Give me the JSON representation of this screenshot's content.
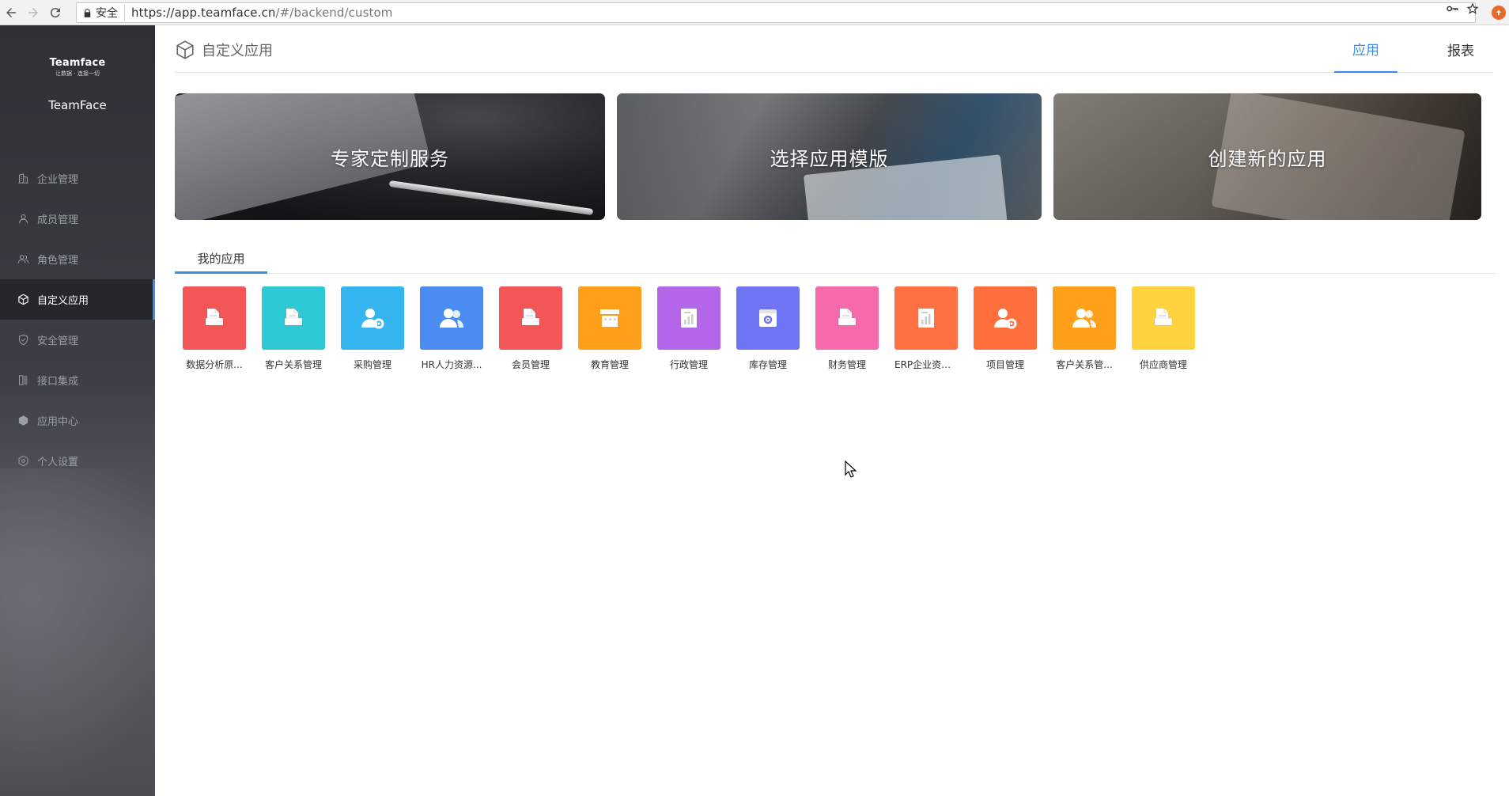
{
  "browser": {
    "security_label": "安全",
    "url_host": "https://app.teamface.cn",
    "url_path": "/#/backend/custom"
  },
  "sidebar": {
    "logo_text": "Teamface",
    "logo_sub": "让数据 · 连接一切",
    "org_name": "TeamFace",
    "items": [
      {
        "label": "企业管理",
        "icon": "building-icon"
      },
      {
        "label": "成员管理",
        "icon": "user-icon"
      },
      {
        "label": "角色管理",
        "icon": "users-icon"
      },
      {
        "label": "自定义应用",
        "icon": "cube-icon",
        "active": true
      },
      {
        "label": "安全管理",
        "icon": "shield-icon"
      },
      {
        "label": "接口集成",
        "icon": "plug-icon"
      },
      {
        "label": "应用中心",
        "icon": "box-icon"
      },
      {
        "label": "个人设置",
        "icon": "gear-icon"
      }
    ]
  },
  "header": {
    "title": "自定义应用",
    "tabs": [
      {
        "label": "应用",
        "active": true
      },
      {
        "label": "报表",
        "active": false
      }
    ]
  },
  "banners": [
    {
      "label": "专家定制服务"
    },
    {
      "label": "选择应用模版"
    },
    {
      "label": "创建新的应用"
    }
  ],
  "sub_tabs": [
    {
      "label": "我的应用",
      "active": true
    }
  ],
  "apps": [
    {
      "name": "数据分析原...",
      "color": "#f25656",
      "icon": "doc-icon"
    },
    {
      "name": "客户关系管理",
      "color": "#2ec9d4",
      "icon": "doc-icon"
    },
    {
      "name": "采购管理",
      "color": "#35b5f0",
      "icon": "user-gear-icon"
    },
    {
      "name": "HR人力资源...",
      "color": "#4a8cf2",
      "icon": "users-icon"
    },
    {
      "name": "会员管理",
      "color": "#f25656",
      "icon": "doc-icon"
    },
    {
      "name": "教育管理",
      "color": "#ff9f1a",
      "icon": "store-icon"
    },
    {
      "name": "行政管理",
      "color": "#b366e8",
      "icon": "chart-doc-icon"
    },
    {
      "name": "库存管理",
      "color": "#6f74f2",
      "icon": "box-gear-icon"
    },
    {
      "name": "财务管理",
      "color": "#f46aab",
      "icon": "doc-icon"
    },
    {
      "name": "ERP企业资源...",
      "color": "#ff7043",
      "icon": "chart-doc-icon"
    },
    {
      "name": "项目管理",
      "color": "#ff6f3c",
      "icon": "user-gear-icon"
    },
    {
      "name": "客户关系管...",
      "color": "#ff9f1a",
      "icon": "users-icon"
    },
    {
      "name": "供应商管理",
      "color": "#ffd23f",
      "icon": "doc-icon"
    }
  ]
}
